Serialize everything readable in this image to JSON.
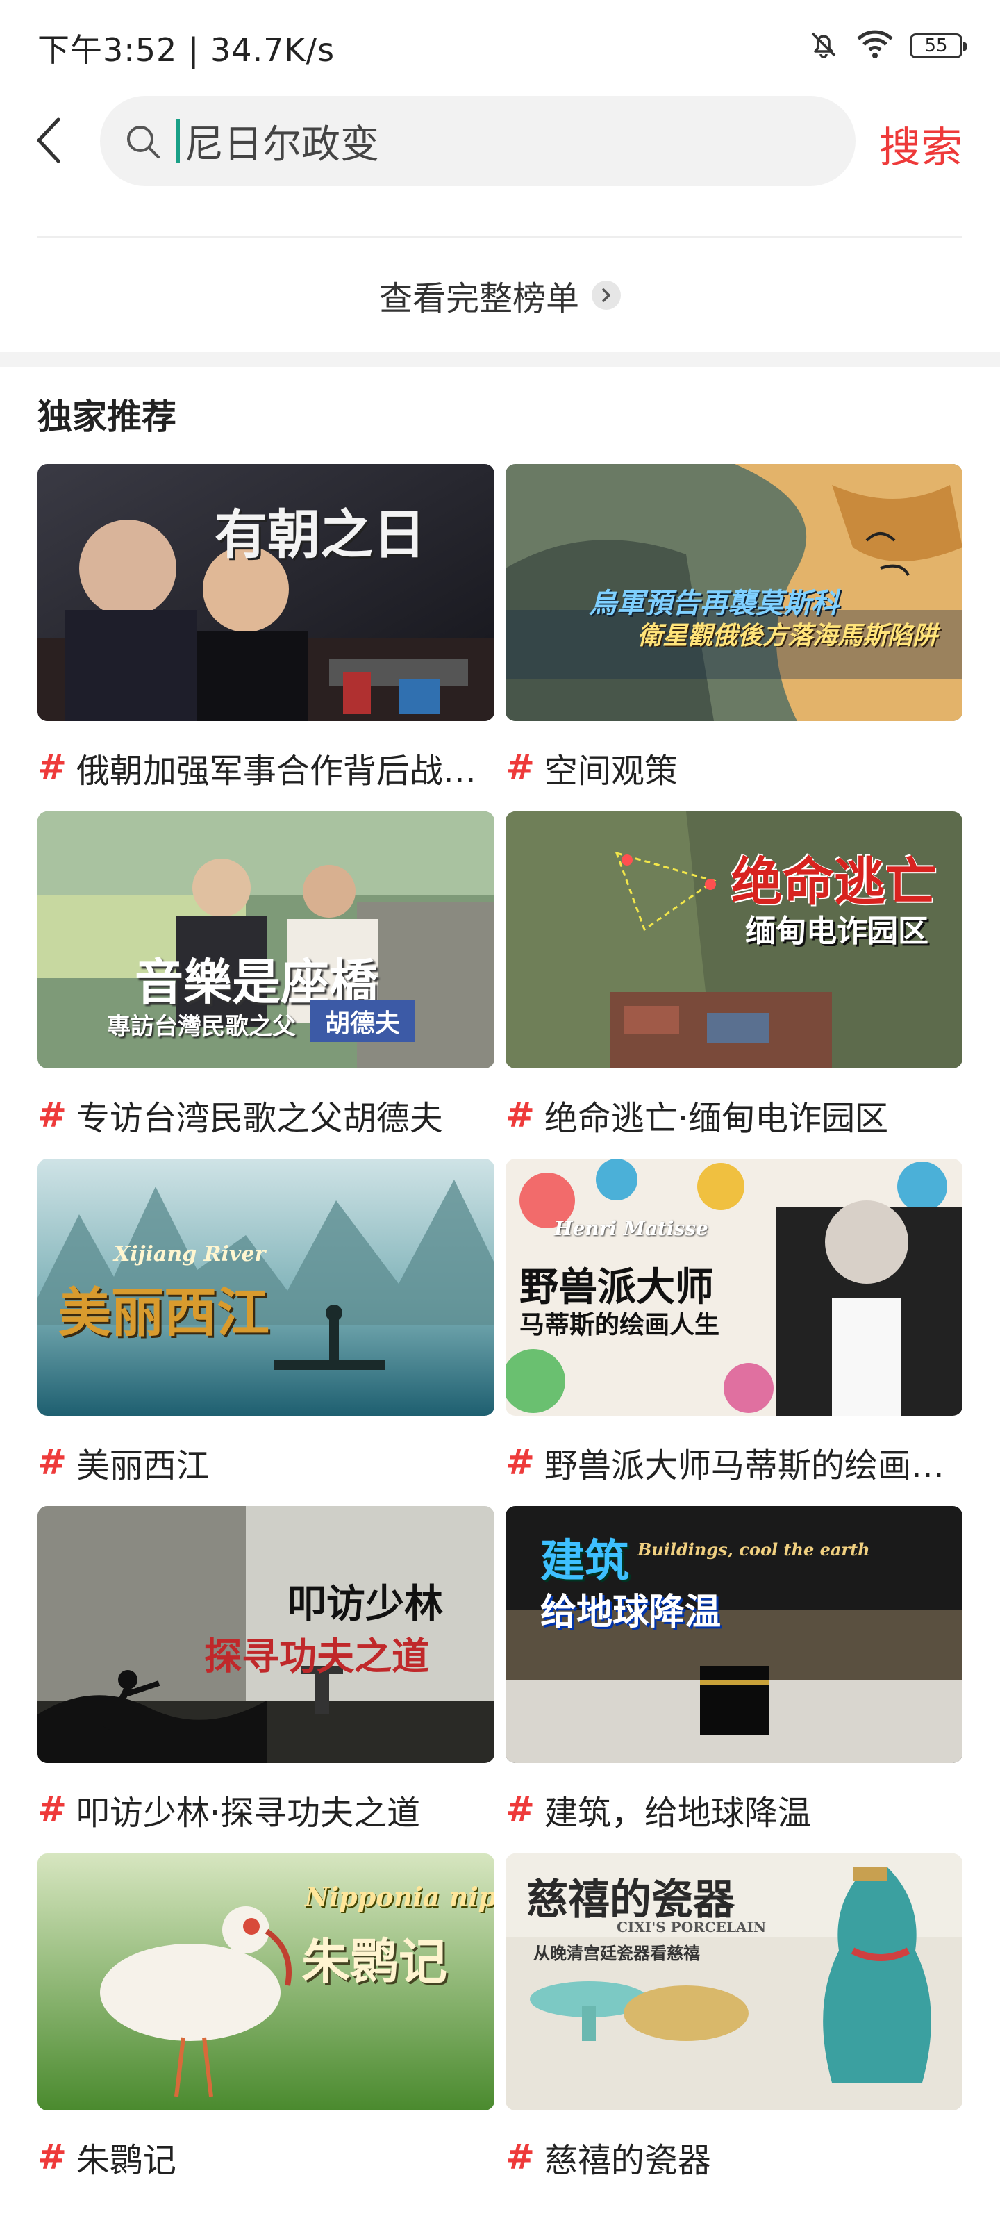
{
  "status_bar": {
    "time_speed": "下午3:52 | 34.7K/s",
    "battery": "55"
  },
  "search": {
    "query": "尼日尔政变",
    "action_label": "搜索"
  },
  "full_list": {
    "label": "查看完整榜单"
  },
  "section": {
    "title": "独家推荐"
  },
  "cards": [
    {
      "hash": "#",
      "label": "俄朝加强军事合作背后战…",
      "thumb_title": "有朝之日"
    },
    {
      "hash": "#",
      "label": "空间观策",
      "thumb_title": "烏軍預告再襲莫斯科",
      "thumb_sub": "衛星觀俄後方落海馬斯陷阱"
    },
    {
      "hash": "#",
      "label": "专访台湾民歌之父胡德夫",
      "thumb_title": "音樂是座橋",
      "thumb_sub": "專訪台灣民歌之父",
      "thumb_tag": "胡德夫"
    },
    {
      "hash": "#",
      "label": "绝命逃亡·缅甸电诈园区",
      "thumb_title": "绝命逃亡",
      "thumb_sub": "缅甸电诈园区"
    },
    {
      "hash": "#",
      "label": "美丽西江",
      "thumb_title": "美丽西江",
      "thumb_sub": "Xijiang River"
    },
    {
      "hash": "#",
      "label": "野兽派大师马蒂斯的绘画…",
      "thumb_title": "野兽派大师",
      "thumb_sub": "马蒂斯的绘画人生",
      "thumb_tag": "Henri Matisse"
    },
    {
      "hash": "#",
      "label": "叩访少林·探寻功夫之道",
      "thumb_title": "叩访少林",
      "thumb_sub": "探寻功夫之道"
    },
    {
      "hash": "#",
      "label": "建筑，给地球降温",
      "thumb_title": "建筑",
      "thumb_sub": "给地球降温",
      "thumb_tag": "Buildings, cool the earth"
    },
    {
      "hash": "#",
      "label": "朱鹮记",
      "thumb_title": "朱鹮记",
      "thumb_sub": "Nipponia nippon"
    },
    {
      "hash": "#",
      "label": "慈禧的瓷器",
      "thumb_title": "慈禧的瓷器",
      "thumb_sub": "CIXI'S PORCELAIN",
      "thumb_tag": "从晚清宫廷瓷器看慈禧"
    }
  ],
  "colors": {
    "accent_red": "#ee3a3a",
    "caret_teal": "#1aa087",
    "search_bg": "#f2f2f2"
  }
}
